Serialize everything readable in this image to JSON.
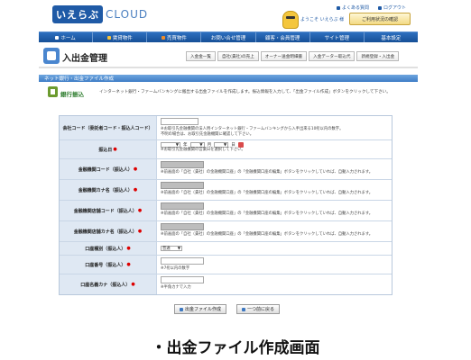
{
  "header": {
    "logo_jp": "いえらぶ",
    "logo_cloud": "CLOUD",
    "links": [
      "よくある質問",
      "ログアウト"
    ],
    "welcome": "ようこそ いえらぶ 様",
    "status_button": "ご利用状況の確認"
  },
  "nav": {
    "items": [
      {
        "label": "ホーム",
        "icon_color": "#ffffff"
      },
      {
        "label": "賃貸物件",
        "icon_color": "#f5c23a"
      },
      {
        "label": "売買物件",
        "icon_color": "#f08c2a"
      },
      {
        "label": "お問い合せ管理",
        "icon_color": "#ffffff"
      },
      {
        "label": "顧客・会員管理",
        "icon_color": "#ffffff"
      },
      {
        "label": "サイト管理",
        "icon_color": "#ffffff"
      },
      {
        "label": "基本設定",
        "icon_color": "#ffffff"
      }
    ]
  },
  "page": {
    "title": "入出金管理",
    "subtabs": [
      "入金金一覧",
      "自社(貴社)の売上",
      "オーナー送金明細書",
      "入金データー取込代",
      "新規登録・入出金"
    ]
  },
  "section": {
    "bar": "ネット銀行・出金ファイル作成",
    "heading": "銀行振込",
    "description": "インターネット銀行・ファームバンキングに搬出する出金ファイルを作成します。振込情報を入力して、「出金ファイル作成」ボタンをクリックして下さい。"
  },
  "form": {
    "rows": [
      {
        "label": "会社コード（委託者コード・振込人コード）",
        "required": false,
        "kind": "text",
        "notes": [
          "※お取引先金融機関の法人用インターネット銀行・ファームバンキングから入手出来る10桁以内の数字。",
          "不明の場合は、お取引先金融機関に確認して下さい。"
        ]
      },
      {
        "label": "振込日",
        "required": true,
        "kind": "date",
        "year_suffix": "年",
        "month_suffix": "月",
        "day_suffix": "日",
        "notes": [
          "※お取引先金融機関の営業日を選択して下さい。"
        ]
      },
      {
        "label": "金融機関コード（振込人）",
        "required": true,
        "kind": "gray",
        "notes": [
          "※前画面の「自社（貴社）の金融機関口座」の「金融機関口座の編集」ボタンをクリックしていれば、自動入力されます。"
        ]
      },
      {
        "label": "金融機関カナ名（振込人）",
        "required": true,
        "kind": "gray",
        "notes": [
          "※前画面の「自社（貴社）の金融機関口座」の「金融機関口座の編集」ボタンをクリックしていれば、自動入力されます。"
        ]
      },
      {
        "label": "金融機関店舗コード（振込人）",
        "required": true,
        "kind": "gray",
        "notes": [
          "※前画面の「自社（貴社）の金融機関口座」の「金融機関口座の編集」ボタンをクリックしていれば、自動入力されます。"
        ]
      },
      {
        "label": "金融機関店舗カナ名（振込人）",
        "required": true,
        "kind": "gray",
        "notes": [
          "※前画面の「自社（貴社）の金融機関口座」の「金融機関口座の編集」ボタンをクリックしていれば、自動入力されます。"
        ]
      },
      {
        "label": "口座種別（振込人）",
        "required": true,
        "kind": "select",
        "value": "普通",
        "notes": []
      },
      {
        "label": "口座番号（振込人）",
        "required": true,
        "kind": "text",
        "notes": [
          "※7桁以内の数字"
        ]
      },
      {
        "label": "口座名義カナ（振込人）",
        "required": true,
        "kind": "text",
        "notes": [
          "※半角カナで入力"
        ]
      }
    ]
  },
  "buttons": {
    "create": "出金ファイル作成",
    "back": "一つ前に戻る"
  },
  "caption": "・出金ファイル作成画面"
}
